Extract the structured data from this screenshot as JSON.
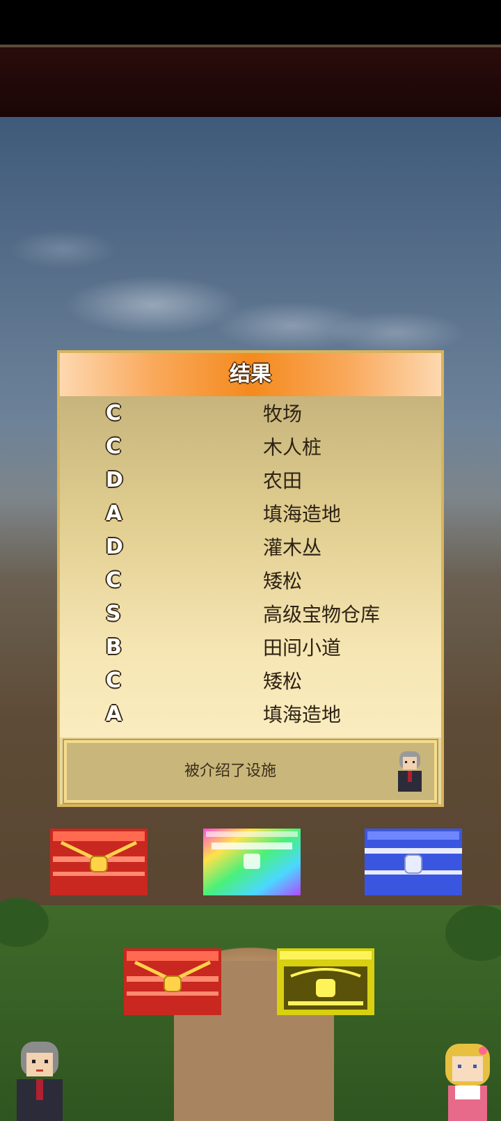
{
  "dialog": {
    "title": "结果",
    "results": [
      {
        "grade": "C",
        "facility": "牧场"
      },
      {
        "grade": "C",
        "facility": "木人桩"
      },
      {
        "grade": "D",
        "facility": "农田"
      },
      {
        "grade": "A",
        "facility": "填海造地"
      },
      {
        "grade": "D",
        "facility": "灌木丛"
      },
      {
        "grade": "C",
        "facility": "矮松"
      },
      {
        "grade": "S",
        "facility": "高级宝物仓库"
      },
      {
        "grade": "B",
        "facility": "田间小道"
      },
      {
        "grade": "C",
        "facility": "矮松"
      },
      {
        "grade": "A",
        "facility": "填海造地"
      }
    ],
    "message": "被介绍了设施"
  },
  "chests": [
    {
      "kind": "red-chest-icon",
      "color": "#e83a2e"
    },
    {
      "kind": "rainbow-chest-icon",
      "color": "#7cf07a"
    },
    {
      "kind": "blue-chest-icon",
      "color": "#3f5ee8"
    },
    {
      "kind": "red-chest-icon",
      "color": "#e83a2e"
    },
    {
      "kind": "gold-chest-icon",
      "color": "#e6e020"
    }
  ]
}
